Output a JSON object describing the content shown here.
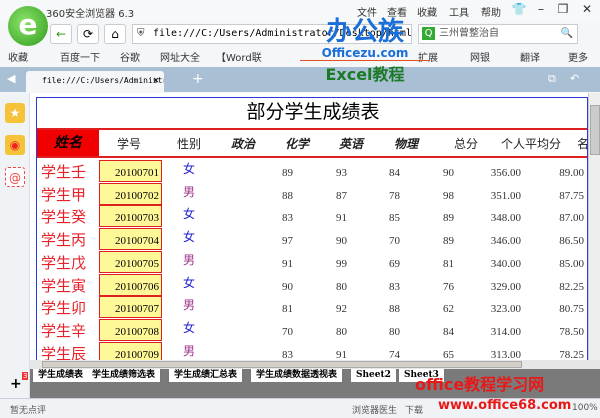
{
  "browser": {
    "title": "360安全浏览器 6.3",
    "menu": [
      "文件",
      "查看",
      "收藏",
      "工具",
      "帮助"
    ],
    "address": "file:///C:/Users/Administrator/Desktop/html/学生",
    "search_value": "三州曾整治自",
    "bookmarks": [
      "收藏",
      "百度一下",
      "谷歌",
      "网址大全",
      "【Word联"
    ],
    "extensions": [
      "扩展",
      "网银",
      "翻译",
      "更多"
    ],
    "tab_title": "file:///C:/Users/Administra"
  },
  "watermark": {
    "brand": "办公族",
    "site": "Officezu.com",
    "subtitle": "Excel教程",
    "bottom_title": "office教程学习网",
    "bottom_url": "www.office68.com"
  },
  "sheet": {
    "title": "部分学生成绩表",
    "headers": [
      "姓名",
      "学号",
      "性别",
      "政治",
      "化学",
      "英语",
      "物理",
      "总分",
      "个人平均分",
      "名"
    ],
    "rows": [
      [
        "学生壬",
        "20100701",
        "女",
        "89",
        "93",
        "84",
        "90",
        "356.00",
        "89.00"
      ],
      [
        "学生甲",
        "20100702",
        "男",
        "88",
        "87",
        "78",
        "98",
        "351.00",
        "87.75"
      ],
      [
        "学生癸",
        "20100703",
        "女",
        "83",
        "91",
        "85",
        "89",
        "348.00",
        "87.00"
      ],
      [
        "学生丙",
        "20100704",
        "女",
        "97",
        "90",
        "70",
        "89",
        "346.00",
        "86.50"
      ],
      [
        "学生戊",
        "20100705",
        "男",
        "91",
        "99",
        "69",
        "81",
        "340.00",
        "85.00"
      ],
      [
        "学生寅",
        "20100706",
        "女",
        "90",
        "80",
        "83",
        "76",
        "329.00",
        "82.25"
      ],
      [
        "学生卯",
        "20100707",
        "男",
        "81",
        "92",
        "88",
        "62",
        "323.00",
        "80.75"
      ],
      [
        "学生辛",
        "20100708",
        "女",
        "70",
        "80",
        "80",
        "84",
        "314.00",
        "78.50"
      ],
      [
        "学生辰",
        "20100709",
        "男",
        "83",
        "91",
        "74",
        "65",
        "313.00",
        "78.25"
      ]
    ]
  },
  "sheet_tabs": [
    "学生成绩表",
    "学生成绩筛选表",
    "学生成绩汇总表",
    "学生成绩数据透视表",
    "Sheet2",
    "Sheet3"
  ],
  "status": {
    "comment": "暂无点评",
    "doctor": "浏览器医生",
    "download": "下载",
    "zoom": "100%",
    "badge": "3"
  },
  "colors": {
    "female": "#2020d0",
    "male": "#a0308a",
    "name": "#e8202a",
    "header_red": "#f00000",
    "id_fill": "#fff899"
  }
}
